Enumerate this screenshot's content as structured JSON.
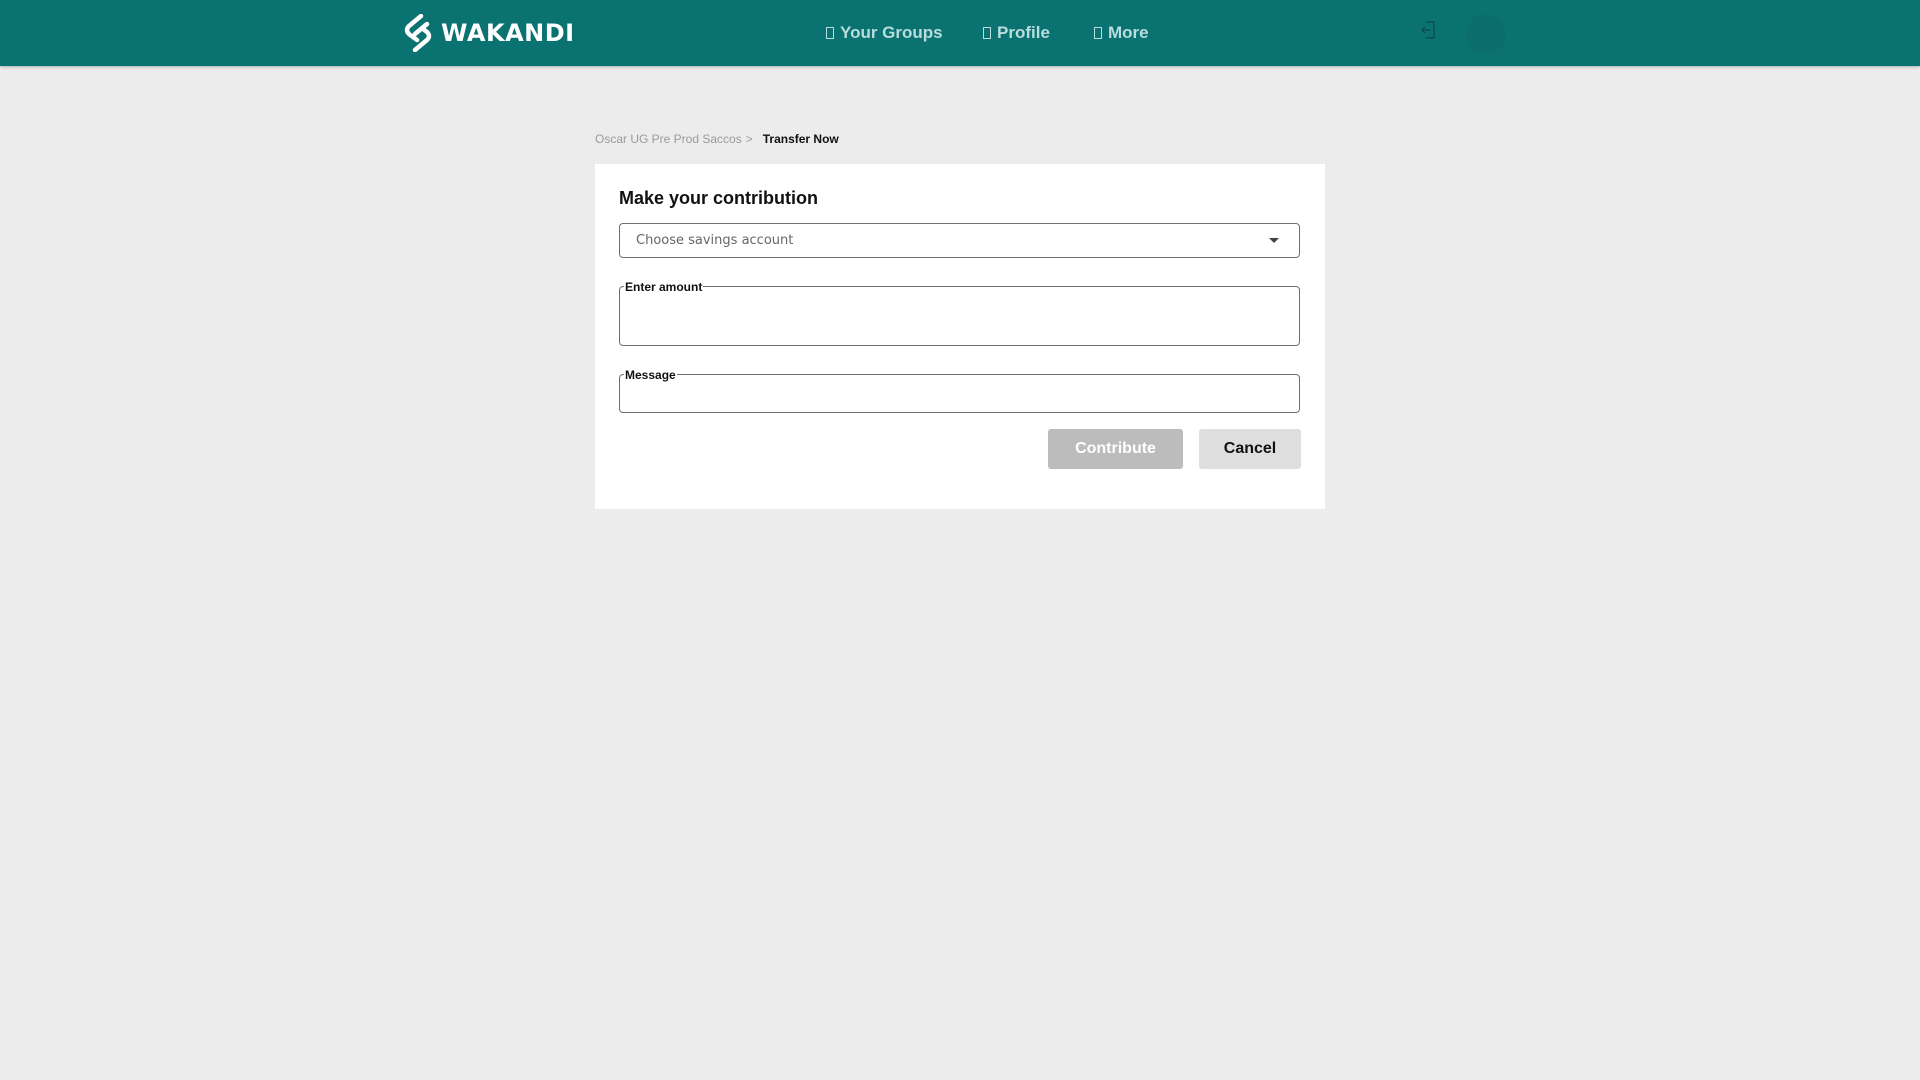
{
  "header": {
    "brand": "WAKANDI",
    "nav": {
      "groups": "Your Groups",
      "profile": "Profile",
      "more": "More"
    }
  },
  "breadcrumb": {
    "parent": "Oscar UG Pre Prod Saccos",
    "separator": ">",
    "current": "Transfer Now"
  },
  "form": {
    "title": "Make your contribution",
    "account_select_placeholder": "Choose savings account",
    "amount_label": "Enter amount",
    "amount_value": "",
    "message_label": "Message",
    "message_value": ""
  },
  "actions": {
    "contribute": "Contribute",
    "cancel": "Cancel"
  },
  "colors": {
    "header_bg": "#0a7271",
    "page_bg": "#ececec",
    "contribute_disabled_bg": "#bcbcbc",
    "cancel_bg": "#dedede"
  },
  "icons": {
    "logo": "wakandi-s-logo-icon",
    "logout": "logout-icon",
    "select": "chevron-down-icon"
  }
}
